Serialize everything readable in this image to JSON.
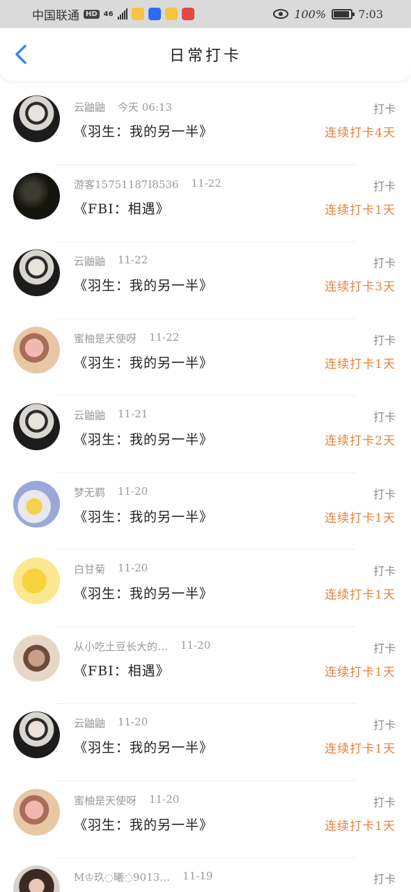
{
  "status_bar": {
    "carrier": "中国联通",
    "hd": "HD",
    "network": "46",
    "battery_pct": "100%",
    "time": "7:03"
  },
  "header": {
    "title": "日常打卡",
    "back_icon": "chevron-left-icon"
  },
  "colors": {
    "accent_blue": "#2d8cf0",
    "streak_orange": "#e8803c"
  },
  "entries": [
    {
      "user": "云鼬鼬",
      "date": "今天 06:13",
      "book": "《羽生：我的另一半》",
      "action": "打卡",
      "streak": "连续打卡4天",
      "avatar": "masked-boy"
    },
    {
      "user": "游客15751187I8536",
      "date": "11-22",
      "book": "《FBI：相遇》",
      "action": "打卡",
      "streak": "连续打卡1天",
      "avatar": "dark-silhouette"
    },
    {
      "user": "云鼬鼬",
      "date": "11-22",
      "book": "《羽生：我的另一半》",
      "action": "打卡",
      "streak": "连续打卡3天",
      "avatar": "masked-boy"
    },
    {
      "user": "蜜柚是天使呀",
      "date": "11-22",
      "book": "《羽生：我的另一半》",
      "action": "打卡",
      "streak": "连续打卡1天",
      "avatar": "cartoon-pig"
    },
    {
      "user": "云鼬鼬",
      "date": "11-21",
      "book": "《羽生：我的另一半》",
      "action": "打卡",
      "streak": "连续打卡2天",
      "avatar": "masked-boy"
    },
    {
      "user": "梦无羁",
      "date": "11-20",
      "book": "《羽生：我的另一半》",
      "action": "打卡",
      "streak": "连续打卡1天",
      "avatar": "boy-with-plush"
    },
    {
      "user": "白甘菊",
      "date": "11-20",
      "book": "《羽生：我的另一半》",
      "action": "打卡",
      "streak": "连续打卡1天",
      "avatar": "pikachu"
    },
    {
      "user": "从小吃土豆长大的…",
      "date": "11-20",
      "book": "《FBI：相遇》",
      "action": "打卡",
      "streak": "连续打卡1天",
      "avatar": "girl-portrait"
    },
    {
      "user": "云鼬鼬",
      "date": "11-20",
      "book": "《羽生：我的另一半》",
      "action": "打卡",
      "streak": "连续打卡1天",
      "avatar": "masked-boy"
    },
    {
      "user": "蜜柚是天使呀",
      "date": "11-20",
      "book": "《羽生：我的另一半》",
      "action": "打卡",
      "streak": "连续打卡1天",
      "avatar": "cartoon-pig"
    },
    {
      "user": "M♔玖◌曦◌9013…",
      "date": "11-19",
      "book": "",
      "action": "打卡",
      "streak": "",
      "avatar": "girl-long-hair"
    }
  ]
}
